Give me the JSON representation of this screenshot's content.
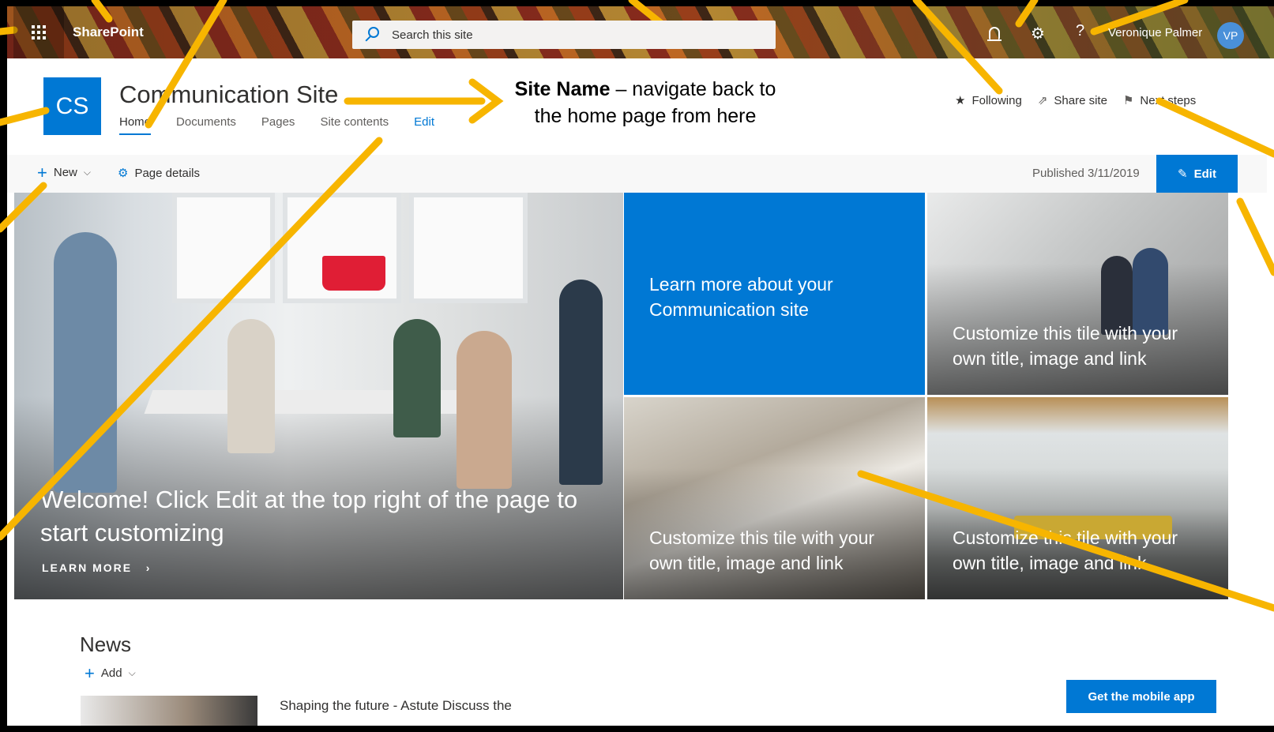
{
  "suite_bar": {
    "brand": "SharePoint",
    "search_placeholder": "Search this site",
    "help_glyph": "?",
    "user_name": "Veronique Palmer",
    "user_initials": "VP"
  },
  "site_header": {
    "logo_initials": "CS",
    "title": "Communication Site",
    "nav": [
      "Home",
      "Documents",
      "Pages",
      "Site contents",
      "Edit"
    ],
    "actions": {
      "following": "Following",
      "share": "Share site",
      "next_steps": "Next steps"
    }
  },
  "command_bar": {
    "new_label": "New",
    "page_details_label": "Page details",
    "published": "Published 3/11/2019",
    "edit_label": "Edit"
  },
  "hero": {
    "main_text": "Welcome! Click Edit at the top right of the page to start customizing",
    "learn_more": "LEARN MORE",
    "tile_blue_text": "Learn more about your Communication site",
    "tile_text": "Customize this tile with your own title, image and link"
  },
  "news": {
    "title": "News",
    "add_label": "Add",
    "headline": "Shaping the future - Astute Discuss the",
    "mobile_button": "Get the mobile app"
  },
  "annotation": {
    "bold": "Site Name",
    "rest": " – navigate back to the home page from here"
  },
  "colors": {
    "accent": "#0078d4",
    "annotation": "#f7b500"
  },
  "icons": [
    "waffle-icon",
    "search-icon",
    "bell-icon",
    "gear-icon",
    "help-icon",
    "star-icon",
    "share-icon",
    "next-steps-icon",
    "plus-icon",
    "chevron-down-icon",
    "pencil-icon",
    "chevron-right-icon"
  ]
}
